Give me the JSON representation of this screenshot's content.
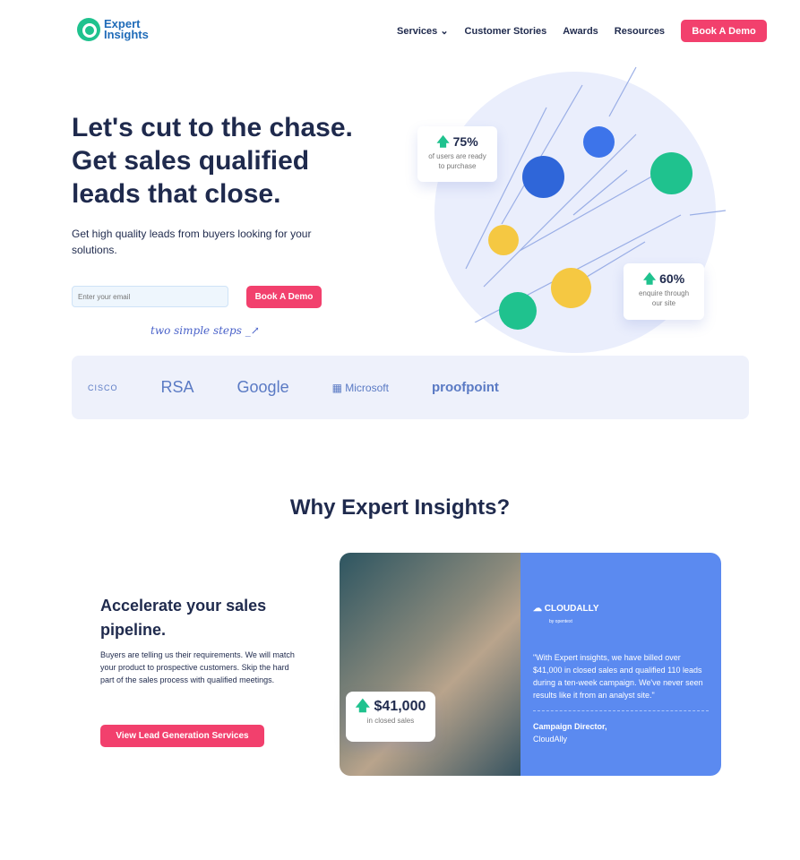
{
  "header": {
    "logo_line1": "Expert",
    "logo_line2": "Insights",
    "nav": [
      "Services",
      "Customer Stories",
      "Awards",
      "Resources"
    ],
    "cta": "Book A Demo"
  },
  "hero": {
    "title": "Let's cut to the chase. Get sales qualified leads that close.",
    "subtitle": "Get high quality leads from buyers looking for your solutions.",
    "email_placeholder": "Enter your email",
    "cta": "Book A Demo",
    "note": "two simple steps"
  },
  "stats": [
    {
      "value": "75%",
      "label": "of users are ready to purchase"
    },
    {
      "value": "60%",
      "label": "enquire through our site"
    }
  ],
  "logos": [
    "CISCO",
    "RSA",
    "Google",
    "Microsoft",
    "proofpoint"
  ],
  "why": {
    "title": "Why Expert Insights?",
    "heading": "Accelerate your sales pipeline.",
    "body": "Buyers are telling us their requirements. We will match your product to prospective customers. Skip the hard part of the sales process with qualified meetings.",
    "cta": "View Lead Generation Services"
  },
  "testimonial": {
    "brand": "CLOUDALLY",
    "brand_sub": "by opentext",
    "quote": "\"With Expert insights, we have billed over $41,000 in closed sales and qualified 110 leads during a ten-week campaign. We've never seen results like it from an analyst site.\"",
    "author": "Campaign Director,",
    "company": "CloudAlly",
    "stat_value": "$41,000",
    "stat_label": "in closed sales"
  },
  "colors": {
    "accent": "#f2406d",
    "green": "#1fc28e",
    "blue": "#5b8af0",
    "navy": "#1f2a4d"
  }
}
